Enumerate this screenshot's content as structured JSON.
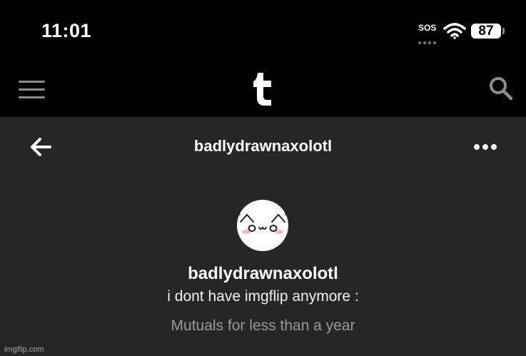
{
  "status_bar": {
    "time": "11:01",
    "sos": "SOS",
    "battery": "87",
    "icons": [
      "wifi-icon",
      "battery-icon"
    ]
  },
  "app_bar": {
    "logo": "t",
    "icons": [
      "menu-icon",
      "search-icon"
    ]
  },
  "header": {
    "title": "badlydrawnaxolotl",
    "icons": [
      "back-arrow-icon",
      "more-options-icon"
    ]
  },
  "profile": {
    "blog_name": "badlydrawnaxolotl",
    "description": "i dont have imgflip anymore :",
    "mutuals": "Mutuals for less than a year"
  },
  "watermark": "imgflip.com",
  "colors": {
    "background": "#000000",
    "panel": "#262626",
    "text": "#ffffff",
    "muted_text": "#9a9a9a",
    "icon_gray": "#8c8c8c",
    "blush": "#f7b8c8"
  }
}
